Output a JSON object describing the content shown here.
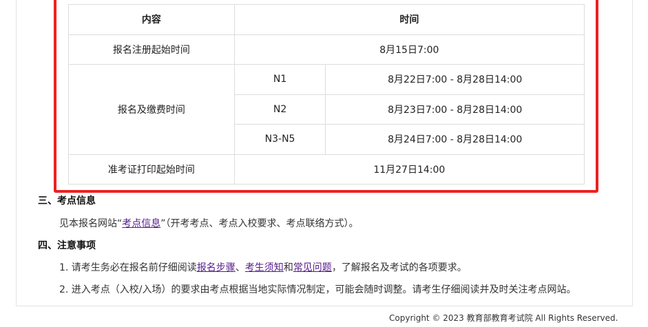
{
  "colors": {
    "highlight": "#ee2020",
    "link": "#551a8b"
  },
  "table": {
    "headers": [
      "内容",
      "时间"
    ],
    "row_register": {
      "label": "报名注册起始时间",
      "time": "8月15日7:00"
    },
    "row_payment": {
      "label": "报名及缴费时间",
      "levels": [
        {
          "level": "N1",
          "time": "8月22日7:00 - 8月28日14:00"
        },
        {
          "level": "N2",
          "time": "8月23日7:00 - 8月28日14:00"
        },
        {
          "level": "N3-N5",
          "time": "8月24日7:00 - 8月28日14:00"
        }
      ]
    },
    "row_admit": {
      "label": "准考证打印起始时间",
      "time": "11月27日14:00"
    }
  },
  "section3": {
    "title": "三、考点信息",
    "text_before": "见本报名网站“",
    "link": "考点信息",
    "text_after": "”（开考考点、考点入校要求、考点联络方式）。"
  },
  "section4": {
    "title": "四、注意事项",
    "item1": {
      "prefix": "1. 请考生务必在报名前仔细阅读",
      "link1": "报名步骤",
      "sep1": "、",
      "link2": "考生须知",
      "sep2": "和",
      "link3": "常见问题",
      "suffix": "，了解报名及考试的各项要求。"
    },
    "item2": "2. 进入考点（入校/入场）的要求由考点根据当地实际情况制定，可能会随时调整。请考生仔细阅读并及时关注考点网站。"
  },
  "footer": {
    "copyright": "Copyright © 2023 教育部教育考试院 All Rights Reserved."
  }
}
